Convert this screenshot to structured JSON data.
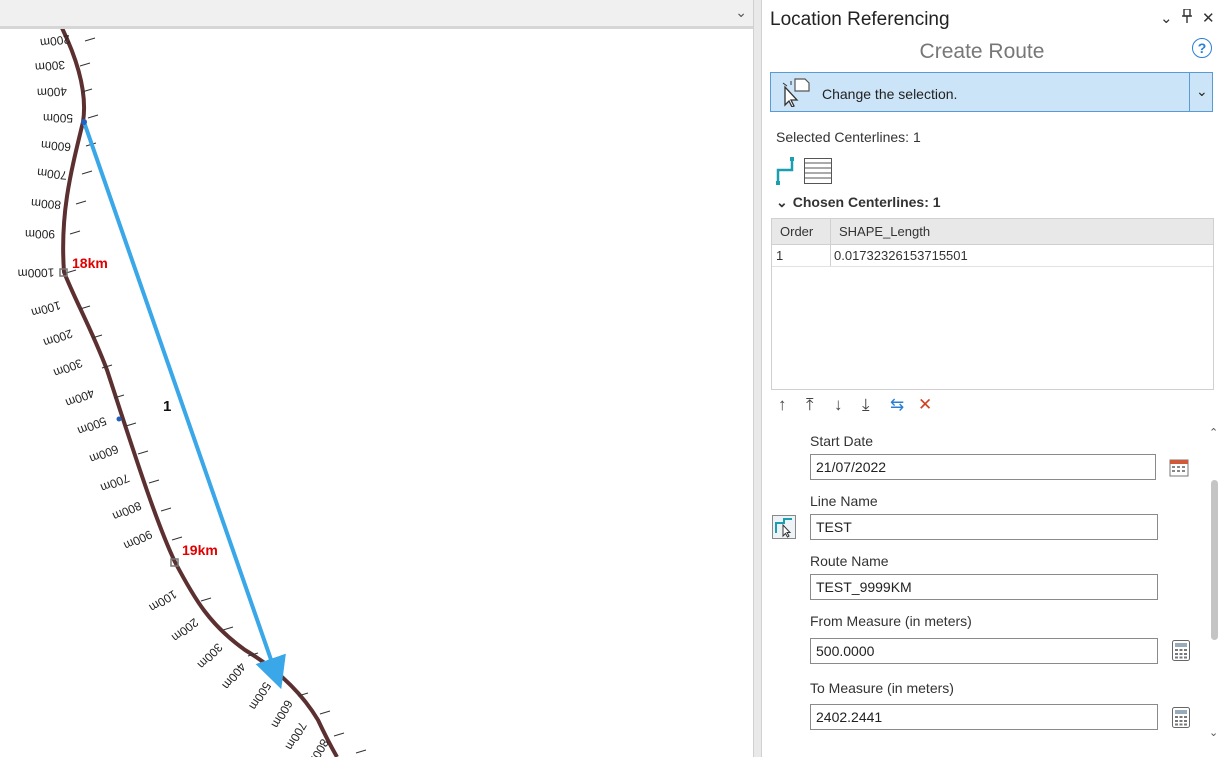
{
  "map": {
    "collapse_glyph": "⌄",
    "route_label": "1",
    "km_labels": [
      {
        "text": "18km",
        "color": "#e00000"
      },
      {
        "text": "19km",
        "color": "#e00000"
      }
    ],
    "measure_ticks_group1": [
      "200m",
      "300m",
      "400m",
      "500m",
      "600m",
      "700m",
      "800m",
      "900m",
      "1000m"
    ],
    "measure_ticks_group2": [
      "100m",
      "200m",
      "300m",
      "400m",
      "500m",
      "600m",
      "700m",
      "800m",
      "900m"
    ],
    "measure_ticks_group3": [
      "100m",
      "200m",
      "300m",
      "400m",
      "500m",
      "600m",
      "700m",
      "800m"
    ],
    "colors": {
      "centerline": "#5c3030",
      "route_arrow": "#3aa7e8",
      "km_label": "#e00000"
    }
  },
  "panel": {
    "title": "Location Referencing",
    "controls": {
      "dropdown": "⌄",
      "pin": "📌",
      "close": "✕"
    },
    "tool_title": "Create Route",
    "help_glyph": "?",
    "selection_dropdown": {
      "label": "Change the selection.",
      "icon": "select-cursor-icon",
      "chevron": "⌄"
    },
    "selected_centerlines": "Selected Centerlines: 1",
    "chosen_section": {
      "chevron": "⌄",
      "header": "Chosen Centerlines: 1",
      "columns": [
        "Order",
        "SHAPE_Length"
      ],
      "rows": [
        [
          "1",
          "0.01732326153715501"
        ]
      ]
    },
    "reorder_buttons": [
      "↑",
      "⤒",
      "↓",
      "⤓",
      "⇆",
      "✕"
    ],
    "fields": {
      "start_date": {
        "label": "Start Date",
        "value": "21/07/2022"
      },
      "line_name": {
        "label": "Line Name",
        "value": "TEST"
      },
      "route_name": {
        "label": "Route Name",
        "value": "TEST_9999KM"
      },
      "from_measure": {
        "label": "From Measure (in meters)",
        "value": "500.0000"
      },
      "to_measure": {
        "label": "To Measure (in meters)",
        "value": "2402.2441"
      }
    },
    "scroll": {
      "up": "⌃",
      "down": "⌄"
    },
    "accent_color": "#cce4f7"
  }
}
